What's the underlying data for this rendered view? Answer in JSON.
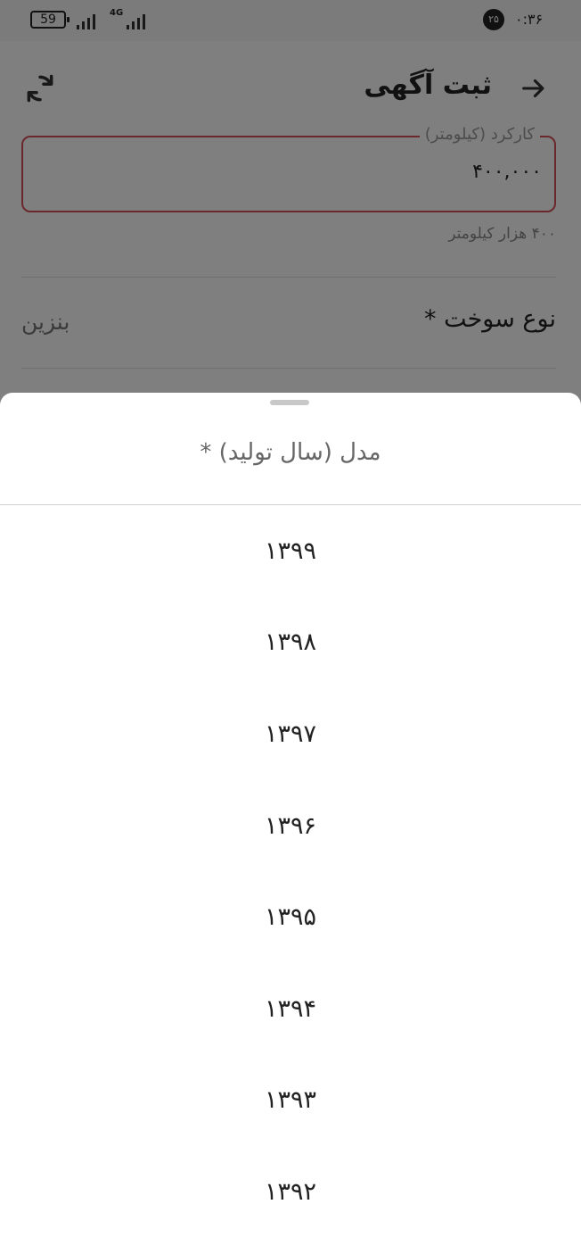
{
  "status_bar": {
    "battery": "59",
    "network": "4G",
    "notification_count": "۲۵",
    "time": "۰:۳۶"
  },
  "header": {
    "title": "ثبت آگهی"
  },
  "form": {
    "mileage": {
      "label": "کارکرد (کیلومتر)",
      "value": "۴۰۰,۰۰۰",
      "hint": "۴۰۰ هزار کیلومتر"
    },
    "fuel": {
      "label": "نوع سوخت *",
      "value": "بنزین"
    }
  },
  "sheet": {
    "title": "مدل (سال تولید) *",
    "options": [
      "۱۳۹۹",
      "۱۳۹۸",
      "۱۳۹۷",
      "۱۳۹۶",
      "۱۳۹۵",
      "۱۳۹۴",
      "۱۳۹۳",
      "۱۳۹۲"
    ]
  }
}
